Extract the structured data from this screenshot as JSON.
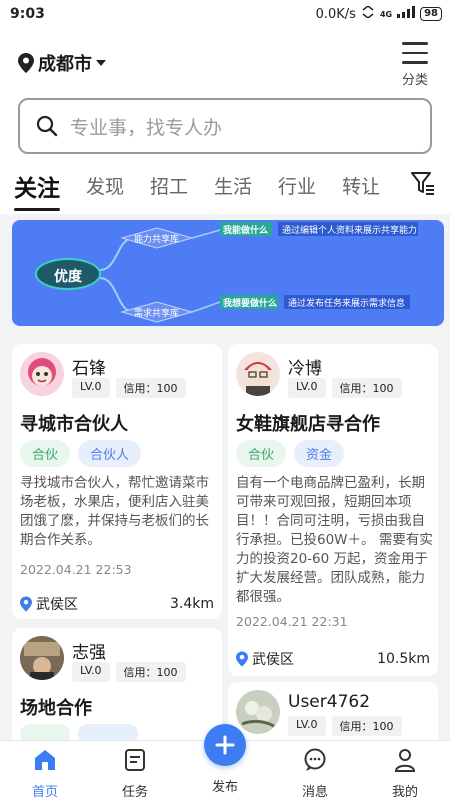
{
  "status_bar": {
    "time": "9:03",
    "speed": "0.0K/s",
    "network": "4G",
    "battery": "98"
  },
  "header": {
    "city": "成都市",
    "menu_label": "分类"
  },
  "search": {
    "placeholder": "专业事，找专人办"
  },
  "tabs": [
    {
      "label": "关注",
      "active": true
    },
    {
      "label": "发现"
    },
    {
      "label": "招工"
    },
    {
      "label": "生活"
    },
    {
      "label": "行业"
    },
    {
      "label": "转让"
    }
  ],
  "banner": {
    "center": "优度",
    "upper_branch": "能力共享库",
    "upper_tag": "我能做什么",
    "upper_desc": "通过编辑个人资料来展示共享能力",
    "lower_branch": "需求共享库",
    "lower_tag": "我想要做什么",
    "lower_desc": "通过发布任务来展示需求信息"
  },
  "cards": [
    {
      "user": "石锋",
      "level": "LV.0",
      "credit": "信用：100",
      "title": "寻城市合伙人",
      "tags": [
        "合伙",
        "合伙人"
      ],
      "desc": "寻找城市合伙人，帮忙邀请菜市场老板，水果店，便利店入驻美团饿了麽，并保持与老板们的长期合作关系。",
      "time": "2022.04.21 22:53",
      "location": "武侯区",
      "distance": "3.4km"
    },
    {
      "user": "冷博",
      "level": "LV.0",
      "credit": "信用：100",
      "title": "女鞋旗舰店寻合作",
      "tags": [
        "合伙",
        "资金"
      ],
      "desc": "自有一个电商品牌已盈利，长期可带来可观回报，短期回本项目！！合同可注明，亏损由我自行承担。已投60W＋。 需要有实力的投资20-60 万起，资金用于扩大发展经营。团队成熟，能力都很强。",
      "time": "2022.04.21 22:31",
      "location": "武侯区",
      "distance": "10.5km"
    },
    {
      "user": "志强",
      "level": "LV.0",
      "credit": "信用：100",
      "title": "场地合作"
    },
    {
      "user": "User4762",
      "level": "LV.0",
      "credit": "信用：100"
    }
  ],
  "bottom_nav": {
    "home": "首页",
    "tasks": "任务",
    "publish": "发布",
    "messages": "消息",
    "mine": "我的"
  },
  "colors": {
    "accent": "#3d7df1",
    "banner_bg": "#4d7cf5",
    "tag_green": "#3aa76a",
    "tag_blue": "#4e7ce8"
  }
}
